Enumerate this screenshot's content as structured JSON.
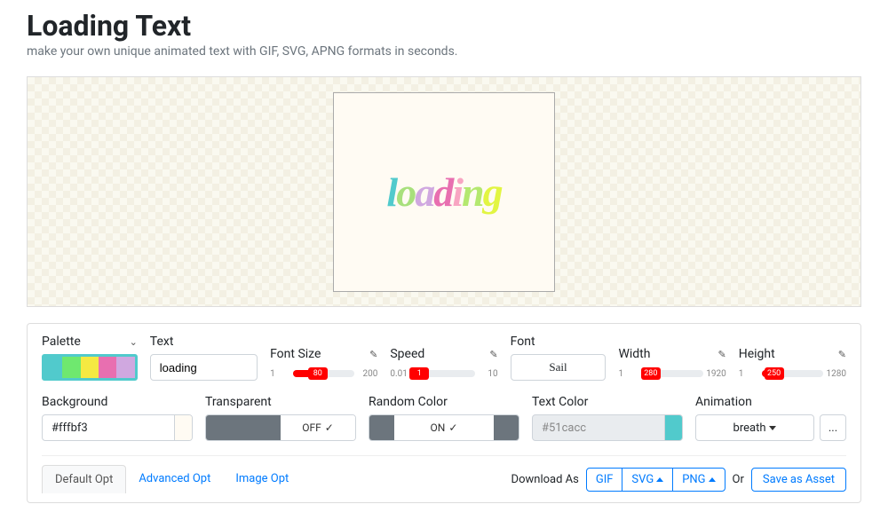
{
  "page": {
    "title": "Loading Text",
    "subtitle": "make your own unique animated text with GIF, SVG, APNG formats in seconds."
  },
  "preview": {
    "text": "loading",
    "bg": "#fffbf3"
  },
  "controls": {
    "palette": {
      "label": "Palette",
      "colors": [
        "#51cacc",
        "#6fe86f",
        "#f5e942",
        "#e86fb0",
        "#d0a8e0"
      ]
    },
    "text": {
      "label": "Text",
      "value": "loading"
    },
    "fontSize": {
      "label": "Font Size",
      "min": "1",
      "max": "200",
      "value": "80",
      "pct": 40
    },
    "speed": {
      "label": "Speed",
      "min": "0.01",
      "max": "10",
      "value": "1",
      "pct": 10
    },
    "font": {
      "label": "Font",
      "value": "Sail"
    },
    "width": {
      "label": "Width",
      "min": "1",
      "max": "1920",
      "value": "280",
      "pct": 15
    },
    "height": {
      "label": "Height",
      "min": "1",
      "max": "1280",
      "value": "250",
      "pct": 20
    },
    "background": {
      "label": "Background",
      "value": "#fffbf3"
    },
    "transparent": {
      "label": "Transparent",
      "value": "OFF"
    },
    "randomColor": {
      "label": "Random Color",
      "value": "ON"
    },
    "textColor": {
      "label": "Text Color",
      "value": "#51cacc",
      "swatch": "#51cacc"
    },
    "animation": {
      "label": "Animation",
      "value": "breath",
      "more": "..."
    }
  },
  "tabs": {
    "default": "Default Opt",
    "advanced": "Advanced Opt",
    "image": "Image Opt"
  },
  "footer": {
    "downloadAs": "Download As",
    "gif": "GIF",
    "svg": "SVG",
    "png": "PNG",
    "or": "Or",
    "save": "Save as Asset"
  }
}
